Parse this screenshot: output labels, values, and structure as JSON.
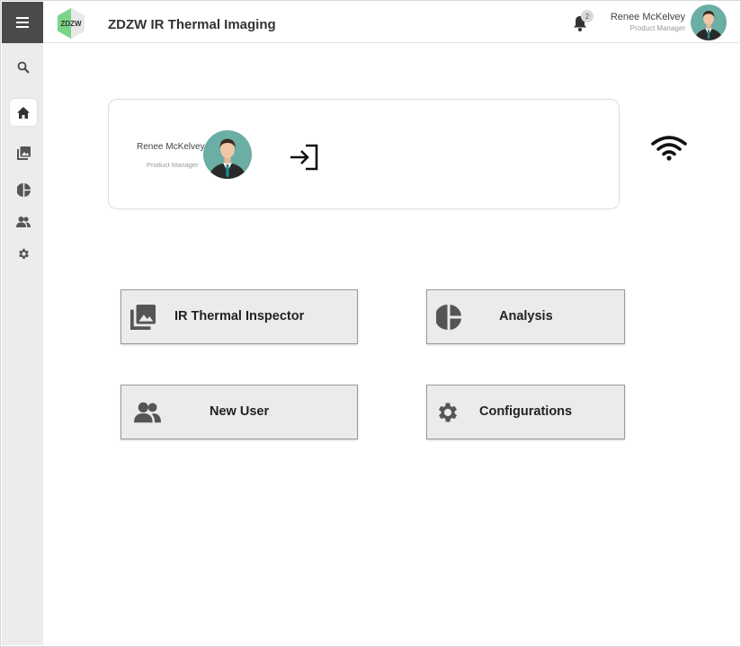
{
  "header": {
    "title": "ZDZW IR Thermal Imaging",
    "logo_text": "ZDZW",
    "notification_count": "2",
    "user_name": "Renee McKelvey",
    "user_role": "Product Manager"
  },
  "sidebar": {
    "items": [
      {
        "name": "search",
        "icon": "search-icon"
      },
      {
        "name": "home",
        "icon": "home-icon",
        "active": true
      },
      {
        "name": "images",
        "icon": "photo-library-icon"
      },
      {
        "name": "analysis",
        "icon": "pie-chart-icon"
      },
      {
        "name": "users",
        "icon": "people-icon"
      },
      {
        "name": "settings",
        "icon": "gear-icon"
      }
    ]
  },
  "profile_card": {
    "name": "Renee McKelvey",
    "role": "Product Manager"
  },
  "actions": {
    "ir_inspector": "IR Thermal Inspector",
    "analysis": "Analysis",
    "new_user": "New User",
    "configurations": "Configurations"
  },
  "colors": {
    "sidebar_bg": "#ececec",
    "menu_bg": "#4a4a4a",
    "tile_bg": "#ebebeb",
    "logo_green": "#7bd48a",
    "avatar_bg": "#6aaea5"
  }
}
